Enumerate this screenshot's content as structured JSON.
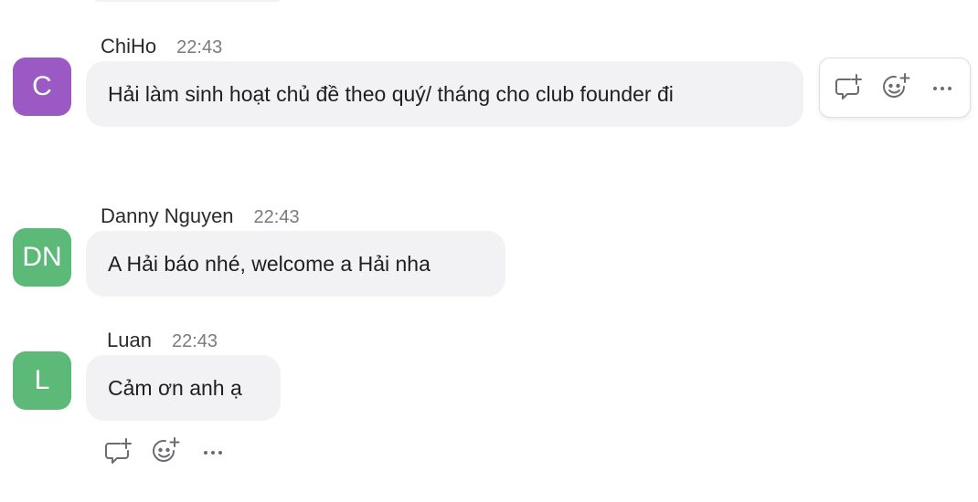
{
  "messages": [
    {
      "name": "ChiHo",
      "time": "22:43",
      "avatar_initials": "C",
      "avatar_color": "#9b59c4",
      "text": "Hải làm sinh hoạt chủ đề theo quý/ tháng cho club founder đi"
    },
    {
      "name": "Danny Nguyen",
      "time": "22:43",
      "avatar_initials": "DN",
      "avatar_color": "#5cb978",
      "text": "A Hải báo nhé, welcome a Hải nha"
    },
    {
      "name": "Luan",
      "time": "22:43",
      "avatar_initials": "L",
      "avatar_color": "#5cb978",
      "text": "Cảm ơn anh ạ"
    }
  ],
  "actions": {
    "reply_icon": "reply-in-thread-icon",
    "react_icon": "add-reaction-icon",
    "more_icon": "more-options-icon"
  },
  "colors": {
    "bubble": "#f2f2f5",
    "icon": "#6b6b73",
    "timestamp": "#7a7a80"
  }
}
